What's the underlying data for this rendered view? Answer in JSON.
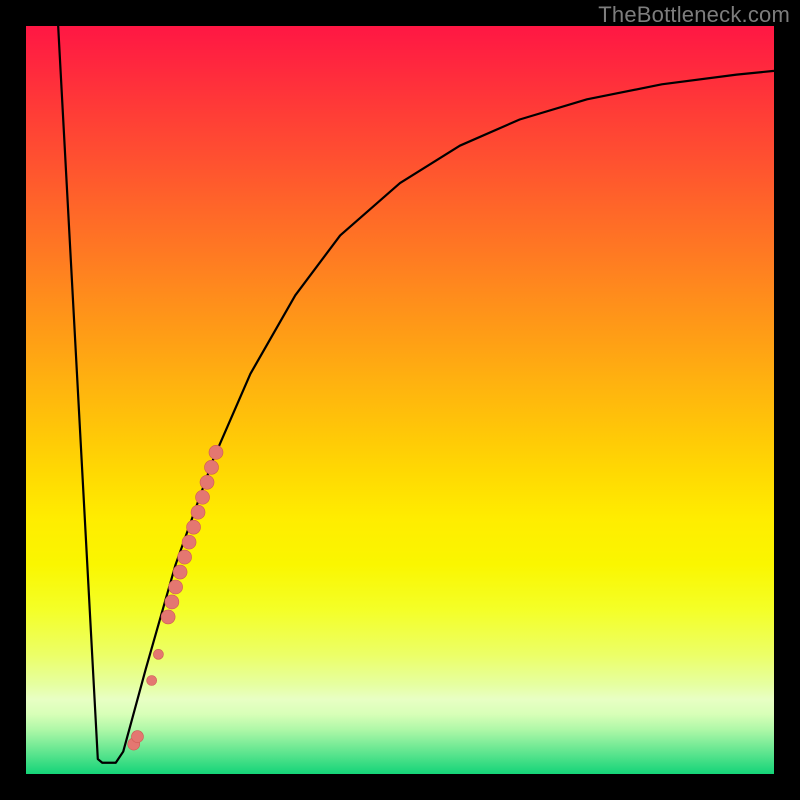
{
  "watermark": "TheBottleneck.com",
  "colors": {
    "frame": "#000000",
    "curve_stroke": "#000000",
    "marker_fill": "#e47771",
    "marker_stroke": "#cf5a54"
  },
  "chart_data": {
    "type": "line",
    "title": "",
    "xlabel": "",
    "ylabel": "",
    "xlim": [
      0,
      100
    ],
    "ylim": [
      0,
      100
    ],
    "grid": false,
    "axes_hidden": true,
    "curve": [
      {
        "x": 4.3,
        "y": 100
      },
      {
        "x": 9.6,
        "y": 2.0
      },
      {
        "x": 10.2,
        "y": 1.5
      },
      {
        "x": 12.0,
        "y": 1.5
      },
      {
        "x": 13.0,
        "y": 3.0
      },
      {
        "x": 16.0,
        "y": 14.0
      },
      {
        "x": 20.0,
        "y": 28.0
      },
      {
        "x": 25.0,
        "y": 42.0
      },
      {
        "x": 30.0,
        "y": 53.5
      },
      {
        "x": 36.0,
        "y": 64.0
      },
      {
        "x": 42.0,
        "y": 72.0
      },
      {
        "x": 50.0,
        "y": 79.0
      },
      {
        "x": 58.0,
        "y": 84.0
      },
      {
        "x": 66.0,
        "y": 87.5
      },
      {
        "x": 75.0,
        "y": 90.2
      },
      {
        "x": 85.0,
        "y": 92.2
      },
      {
        "x": 95.0,
        "y": 93.5
      },
      {
        "x": 100.0,
        "y": 94.0
      }
    ],
    "markers": [
      {
        "x": 14.4,
        "y": 4.0,
        "r": 6
      },
      {
        "x": 14.9,
        "y": 5.0,
        "r": 6
      },
      {
        "x": 16.8,
        "y": 12.5,
        "r": 5
      },
      {
        "x": 17.7,
        "y": 16.0,
        "r": 5
      },
      {
        "x": 19.0,
        "y": 21.0,
        "r": 7
      },
      {
        "x": 19.5,
        "y": 23.0,
        "r": 7
      },
      {
        "x": 20.0,
        "y": 25.0,
        "r": 7
      },
      {
        "x": 20.6,
        "y": 27.0,
        "r": 7
      },
      {
        "x": 21.2,
        "y": 29.0,
        "r": 7
      },
      {
        "x": 21.8,
        "y": 31.0,
        "r": 7
      },
      {
        "x": 22.4,
        "y": 33.0,
        "r": 7
      },
      {
        "x": 23.0,
        "y": 35.0,
        "r": 7
      },
      {
        "x": 23.6,
        "y": 37.0,
        "r": 7
      },
      {
        "x": 24.2,
        "y": 39.0,
        "r": 7
      },
      {
        "x": 24.8,
        "y": 41.0,
        "r": 7
      },
      {
        "x": 25.4,
        "y": 43.0,
        "r": 7
      }
    ]
  }
}
